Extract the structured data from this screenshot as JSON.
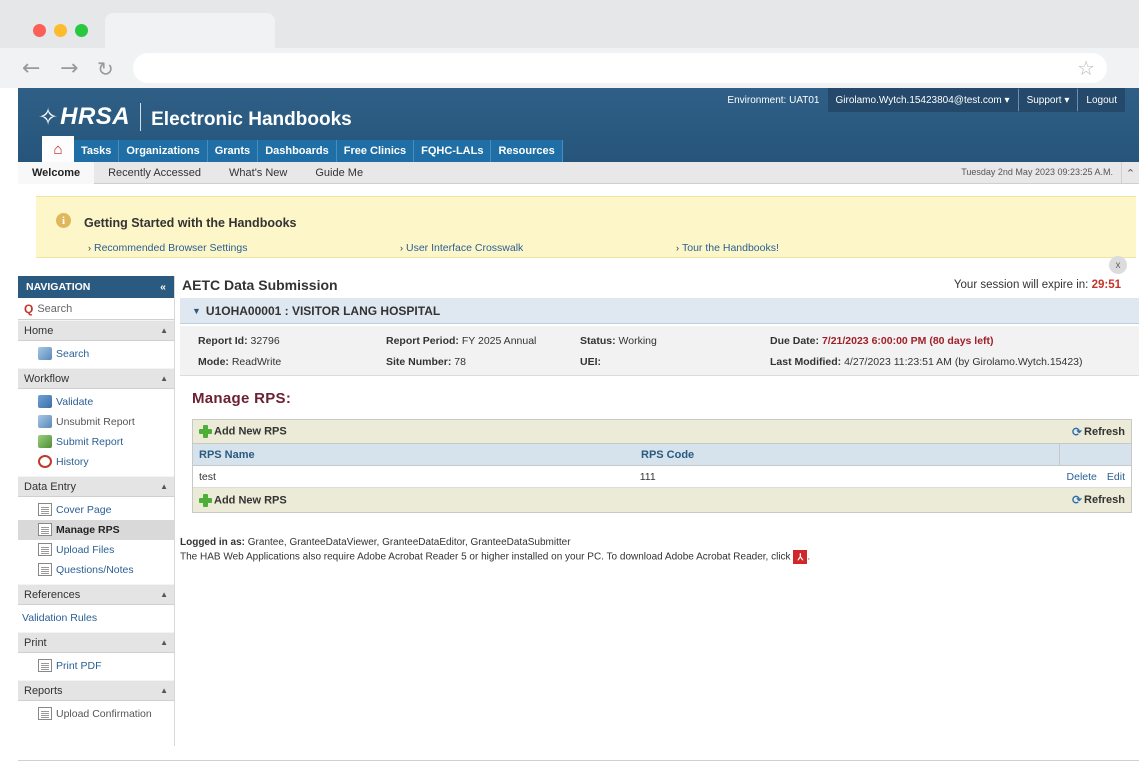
{
  "app": {
    "logo_text": "HRSA",
    "title": "Electronic Handbooks",
    "environment": "Environment: UAT01",
    "user": "Girolamo.Wytch.15423804@test.com",
    "support": "Support",
    "logout": "Logout"
  },
  "tabs": [
    "Tasks",
    "Organizations",
    "Grants",
    "Dashboards",
    "Free Clinics",
    "FQHC-LALs",
    "Resources"
  ],
  "subnav": {
    "items": [
      "Welcome",
      "Recently Accessed",
      "What's New",
      "Guide Me"
    ],
    "date": "Tuesday 2nd May 2023 09:23:25 A.M."
  },
  "banner": {
    "title": "Getting Started with the Handbooks",
    "links": [
      "Recommended Browser Settings",
      "User Interface Crosswalk",
      "Tour the Handbooks!"
    ],
    "close": "x"
  },
  "sidebar": {
    "header": "NAVIGATION",
    "search_placeholder": "Search",
    "sections": [
      {
        "title": "Home",
        "items": [
          "Search"
        ]
      },
      {
        "title": "Workflow",
        "items": [
          "Validate",
          "Unsubmit Report",
          "Submit Report",
          "History"
        ]
      },
      {
        "title": "Data Entry",
        "items": [
          "Cover Page",
          "Manage RPS",
          "Upload Files",
          "Questions/Notes"
        ]
      },
      {
        "title": "References",
        "items": [
          "Validation Rules"
        ]
      },
      {
        "title": "Print",
        "items": [
          "Print PDF"
        ]
      },
      {
        "title": "Reports",
        "items": [
          "Upload Confirmation"
        ]
      }
    ]
  },
  "main": {
    "title": "AETC Data Submission",
    "session_label": "Your session will expire in:",
    "session_time": "29:51",
    "grantee": "U1OHA00001 : VISITOR LANG HOSPITAL",
    "details": {
      "report_id_label": "Report Id:",
      "report_id": "32796",
      "mode_label": "Mode:",
      "mode": "ReadWrite",
      "period_label": "Report Period:",
      "period": "FY 2025 Annual",
      "site_label": "Site Number:",
      "site": "78",
      "status_label": "Status:",
      "status": "Working",
      "uei_label": "UEI:",
      "uei": "",
      "due_label": "Due Date:",
      "due": "7/21/2023 6:00:00 PM (80 days left)",
      "modified_label": "Last Modified:",
      "modified": "4/27/2023 11:23:51 AM (by Girolamo.Wytch.15423)"
    },
    "section_title": "Manage RPS:",
    "add_label": "Add New RPS",
    "refresh_label": "Refresh",
    "columns": [
      "RPS Name",
      "RPS Code"
    ],
    "rows": [
      {
        "name": "test",
        "code": "111",
        "delete": "Delete",
        "edit": "Edit"
      }
    ],
    "logged_in_label": "Logged in as:",
    "logged_in_roles": "Grantee, GranteeDataViewer, GranteeDataEditor, GranteeDataSubmitter",
    "acrobat_note": "The HAB Web Applications also require Adobe Acrobat Reader 5 or higher installed on your PC. To download Adobe Acrobat Reader, click"
  },
  "colors": {
    "header_blue": "#2a5a80",
    "tab_blue": "#1f6fa6",
    "accent_red": "#c4342b",
    "banner_yellow": "#fdf6c8"
  }
}
